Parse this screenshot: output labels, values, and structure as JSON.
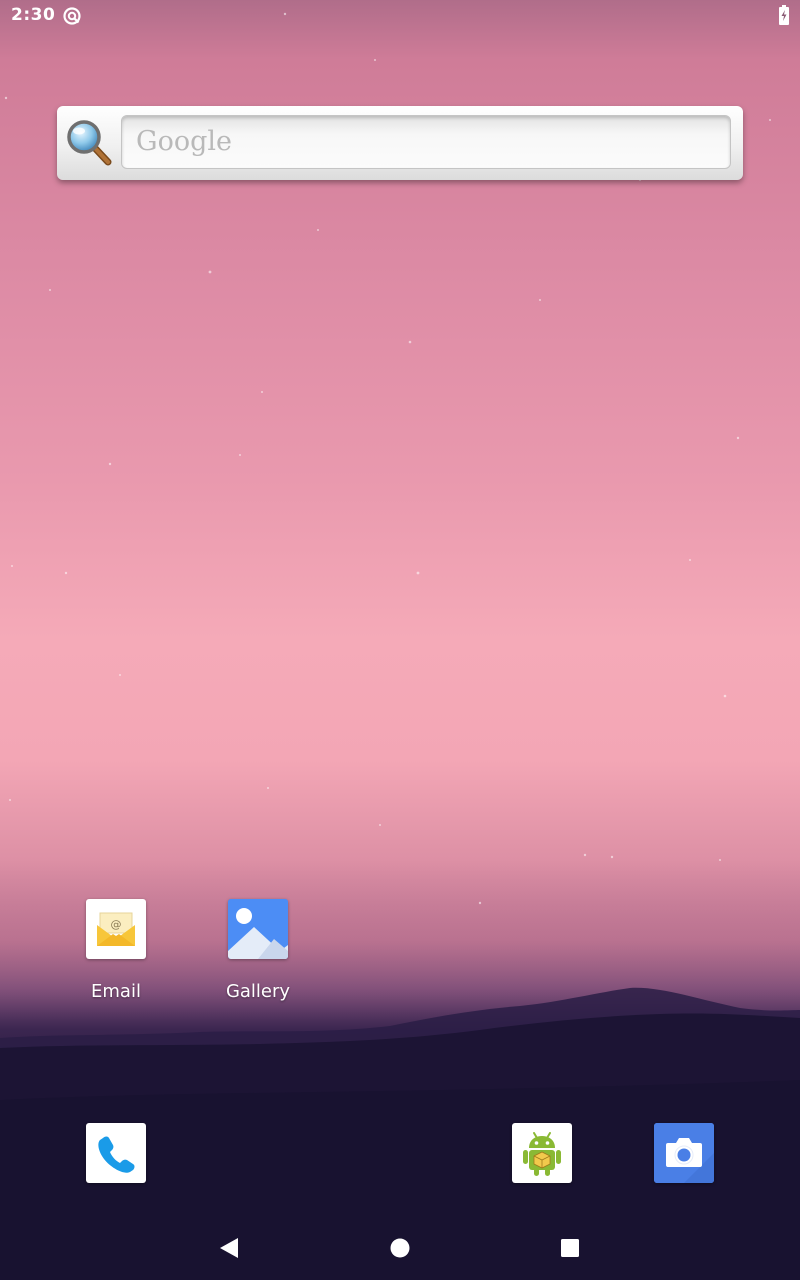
{
  "status_bar": {
    "time": "2:30",
    "left_icon": "sync-status-icon",
    "right_icon": "battery-charging-icon"
  },
  "search_widget": {
    "placeholder": "Google",
    "icon": "magnifier-icon"
  },
  "home_apps": [
    {
      "label": "Email",
      "icon": "email-icon"
    },
    {
      "label": "Gallery",
      "icon": "gallery-icon"
    }
  ],
  "dock_apps": [
    {
      "name": "Phone",
      "icon": "phone-icon"
    },
    {
      "name": "Android app",
      "icon": "android-icon"
    },
    {
      "name": "Camera",
      "icon": "camera-icon"
    }
  ],
  "nav_bar": {
    "back": "back-icon",
    "home": "home-icon",
    "recents": "recents-icon"
  },
  "colors": {
    "camera_bg": "#4a7fe6",
    "gallery_sky": "#4c8df5",
    "phone_blue": "#1a9be8",
    "android_green": "#8ab934",
    "email_envelope": "#f7c63a"
  }
}
